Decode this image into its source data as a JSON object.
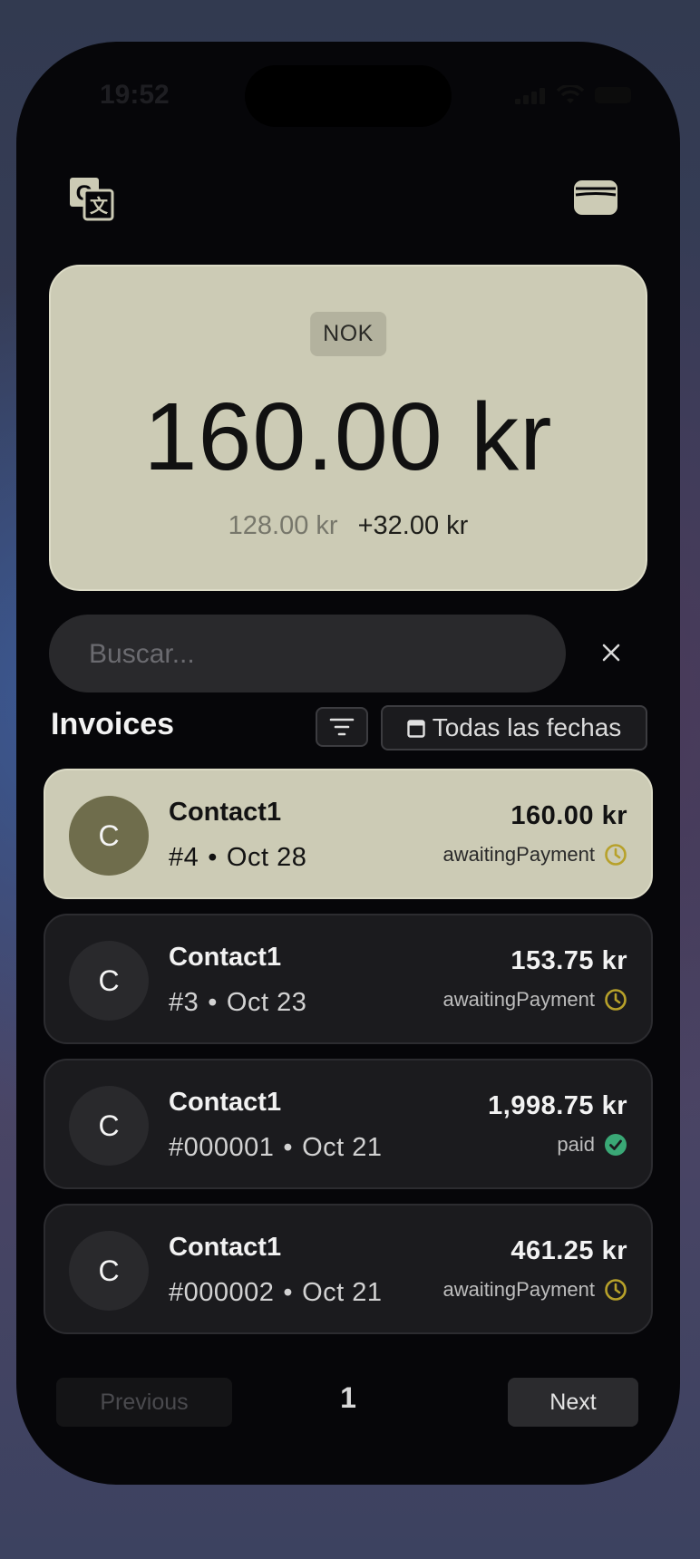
{
  "status_bar": {
    "time": "19:52"
  },
  "balance": {
    "currency": "NOK",
    "amount": "160.00 kr",
    "base": "128.00 kr",
    "delta": "+32.00 kr"
  },
  "search": {
    "placeholder": "Buscar...",
    "value": "",
    "clear_label": "×"
  },
  "invoices": {
    "title": "Invoices",
    "date_filter_label": "Todas las fechas",
    "items": [
      {
        "avatar": "C",
        "contact": "Contact1",
        "number": "#4",
        "date": "Oct 28",
        "amount": "160.00 kr",
        "status": "awaitingPayment",
        "status_icon": "clock-icon",
        "selected": true
      },
      {
        "avatar": "C",
        "contact": "Contact1",
        "number": "#3",
        "date": "Oct 23",
        "amount": "153.75 kr",
        "status": "awaitingPayment",
        "status_icon": "clock-icon"
      },
      {
        "avatar": "C",
        "contact": "Contact1",
        "number": "#000001",
        "date": "Oct 21",
        "amount": "1,998.75 kr",
        "status": "paid",
        "status_icon": "check-circle-icon"
      },
      {
        "avatar": "C",
        "contact": "Contact1",
        "number": "#000002",
        "date": "Oct 21",
        "amount": "461.25 kr",
        "status": "awaitingPayment",
        "status_icon": "clock-icon"
      }
    ]
  },
  "pagination": {
    "previous_label": "Previous",
    "page": "1",
    "next_label": "Next"
  },
  "colors": {
    "card_bg": "#cccbb5",
    "pending": "#b7a12a",
    "paid": "#3aa876"
  }
}
